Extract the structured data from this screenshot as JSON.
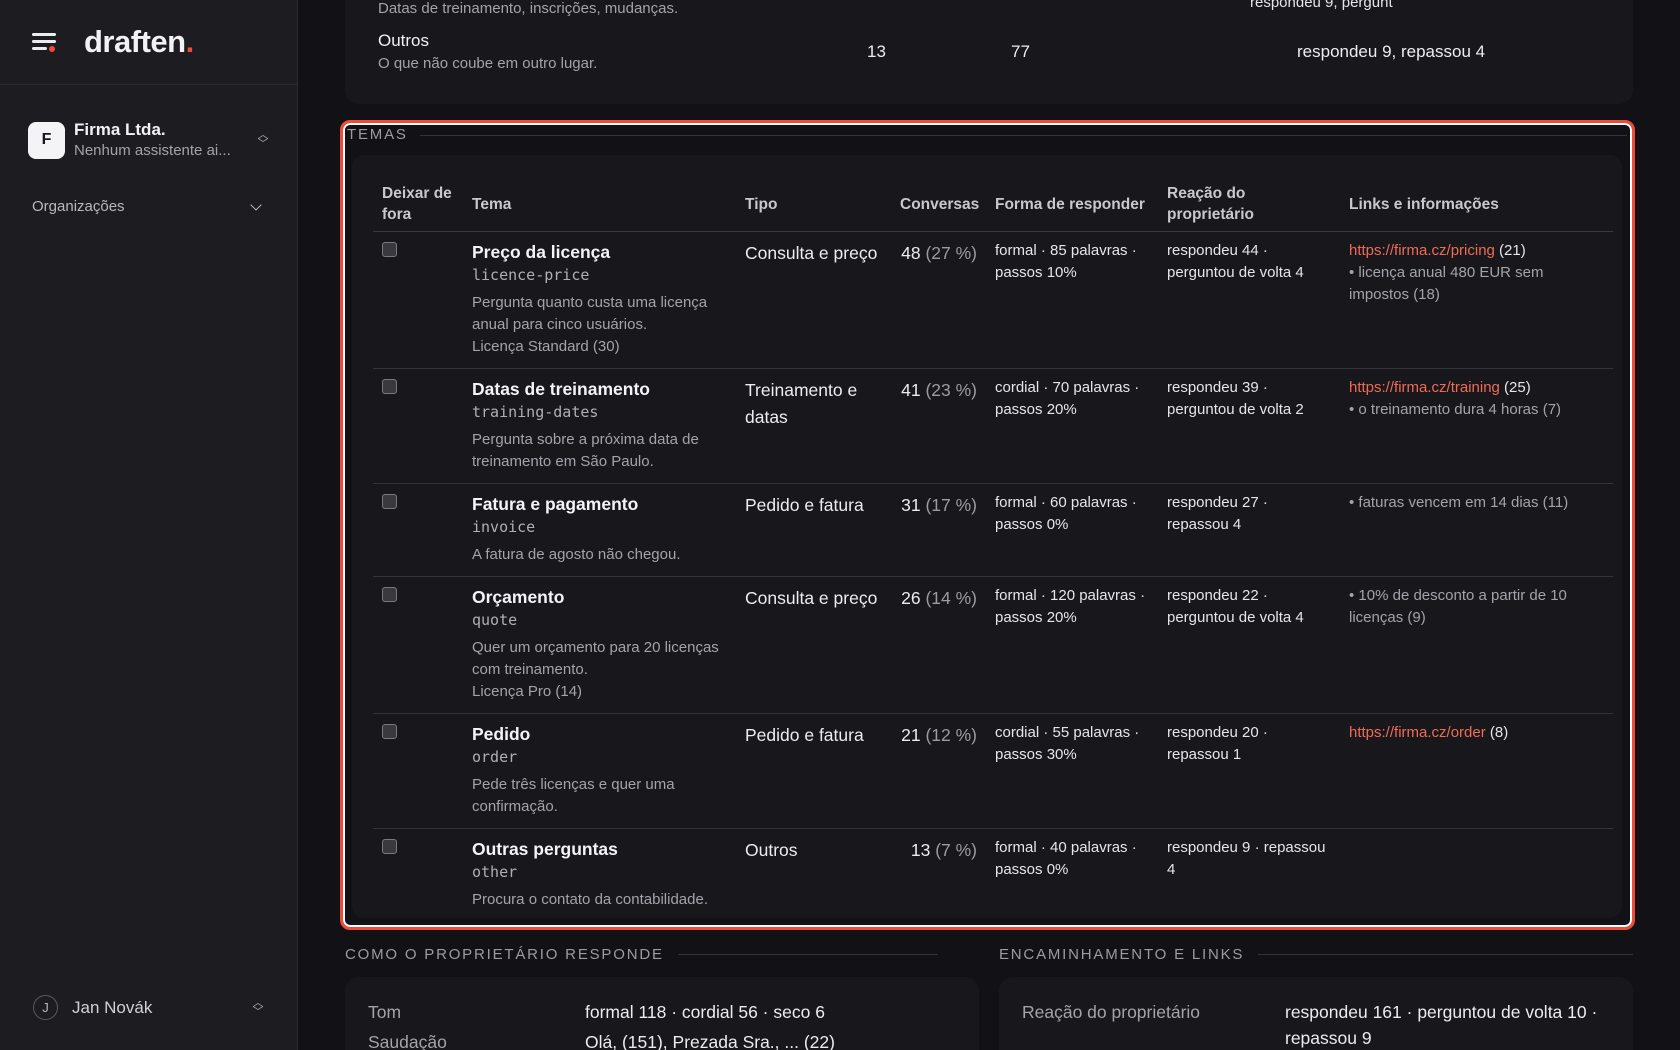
{
  "brand": {
    "logo_text": "draften",
    "logo_dot": "."
  },
  "organization": {
    "initial": "F",
    "name": "Firma Ltda.",
    "subtitle": "Nenhum assistente ai..."
  },
  "nav": {
    "organizations_label": "Organizações"
  },
  "user": {
    "initial": "J",
    "name": "Jan Novák"
  },
  "top_card": {
    "prev_desc": "Datas de treinamento, inscrições, mudanças.",
    "prev_right": "respondeu 9, pergunt",
    "outros": {
      "title": "Outros",
      "desc": "O que não coube em outro lugar.",
      "count": "13",
      "value": "77",
      "reaction": "respondeu 9, repassou 4"
    }
  },
  "temas": {
    "label": "TEMAS",
    "headers": {
      "exclude": "Deixar de fora",
      "tema": "Tema",
      "tipo": "Tipo",
      "conversas": "Conversas",
      "forma": "Forma de responder",
      "reacao": "Reação do proprietário",
      "links": "Links e informações"
    },
    "rows": [
      {
        "name": "Preço da licença",
        "key": "licence-price",
        "desc": "Pergunta quanto custa uma licença anual para cinco usuários.",
        "desc2": "Licença Standard (30)",
        "tipo": "Consulta e preço",
        "count": "48",
        "pct": "(27 %)",
        "forma": "formal · 85 palavras · passos 10%",
        "reacao": "respondeu 44 · perguntou de volta 4",
        "link": "https://firma.cz/pricing",
        "link_count": " (21)",
        "info": "• licença anual 480 EUR sem impostos (18)"
      },
      {
        "name": "Datas de treinamento",
        "key": "training-dates",
        "desc": "Pergunta sobre a próxima data de treinamento em São Paulo.",
        "desc2": "",
        "tipo": "Treinamento e datas",
        "count": "41",
        "pct": "(23 %)",
        "forma": "cordial · 70 palavras · passos 20%",
        "reacao": "respondeu 39 · perguntou de volta 2",
        "link": "https://firma.cz/training",
        "link_count": " (25)",
        "info": "• o treinamento dura 4 horas (7)"
      },
      {
        "name": "Fatura e pagamento",
        "key": "invoice",
        "desc": "A fatura de agosto não chegou.",
        "desc2": "",
        "tipo": "Pedido e fatura",
        "count": "31",
        "pct": "(17 %)",
        "forma": "formal · 60 palavras · passos 0%",
        "reacao": "respondeu 27 · repassou 4",
        "link": "",
        "link_count": "",
        "info": "• faturas vencem em 14 dias (11)"
      },
      {
        "name": "Orçamento",
        "key": "quote",
        "desc": "Quer um orçamento para 20 licenças com treinamento.",
        "desc2": "Licença Pro (14)",
        "tipo": "Consulta e preço",
        "count": "26",
        "pct": "(14 %)",
        "forma": "formal · 120 palavras · passos 20%",
        "reacao": "respondeu 22 · perguntou de volta 4",
        "link": "",
        "link_count": "",
        "info": "• 10% de desconto a partir de 10 licenças (9)"
      },
      {
        "name": "Pedido",
        "key": "order",
        "desc": "Pede três licenças e quer uma confirmação.",
        "desc2": "",
        "tipo": "Pedido e fatura",
        "count": "21",
        "pct": "(12 %)",
        "forma": "cordial · 55 palavras · passos 30%",
        "reacao": "respondeu 20 · repassou 1",
        "link": "https://firma.cz/order",
        "link_count": " (8)",
        "info": ""
      },
      {
        "name": "Outras perguntas",
        "key": "other",
        "desc": "Procura o contato da contabilidade.",
        "desc2": "",
        "tipo": "Outros",
        "count": "13",
        "pct": "(7 %)",
        "forma": "formal · 40 palavras · passos 0%",
        "reacao": "respondeu 9 · repassou 4",
        "link": "",
        "link_count": "",
        "info": ""
      }
    ]
  },
  "bottom": {
    "left_label": "COMO O PROPRIETÁRIO RESPONDE",
    "right_label": "ENCAMINHAMENTO E LINKS",
    "left_rows": [
      {
        "key": "Tom",
        "value": "formal 118 · cordial 56 · seco 6"
      },
      {
        "key": "Saudação",
        "value": "Olá, (151), Prezada Sra., ... (22)"
      }
    ],
    "right_rows": [
      {
        "key": "Reação do proprietário",
        "value": "respondeu 161 · perguntou de volta 10 · repassou 9"
      }
    ]
  }
}
